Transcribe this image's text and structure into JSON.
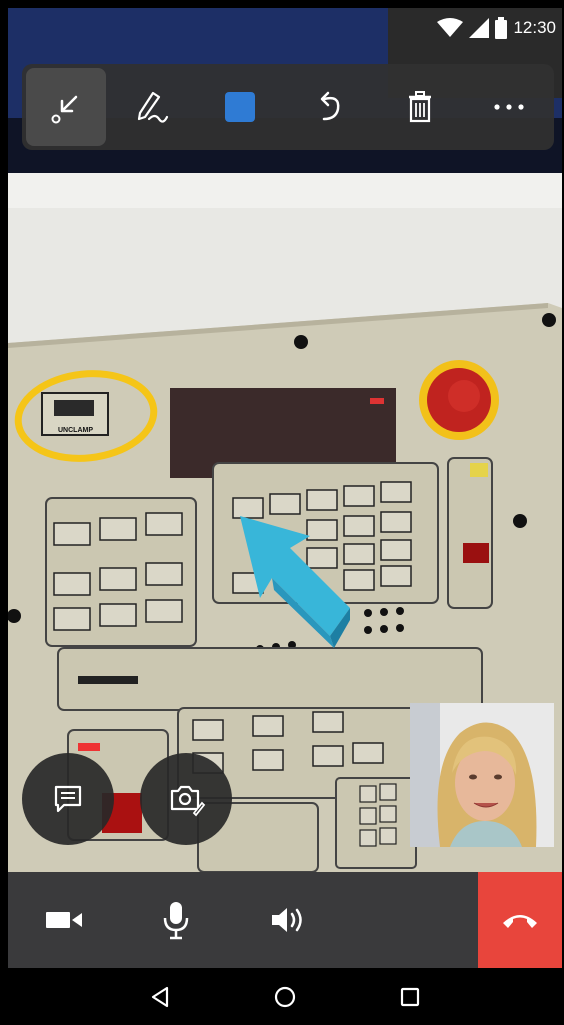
{
  "status_bar": {
    "time": "12:30",
    "icons": [
      "wifi-icon",
      "signal-icon",
      "battery-icon"
    ]
  },
  "toolbar": {
    "tools": [
      {
        "name": "pointer-arrow-tool",
        "icon": "arrow-down-left-icon",
        "active": true
      },
      {
        "name": "pen-tool",
        "icon": "pen-icon"
      },
      {
        "name": "color-tool",
        "icon": "color-swatch",
        "color": "#2f7bd4"
      },
      {
        "name": "undo-tool",
        "icon": "undo-icon"
      },
      {
        "name": "delete-tool",
        "icon": "trash-icon"
      },
      {
        "name": "more-tool",
        "icon": "more-horizontal-icon"
      }
    ]
  },
  "annotations": {
    "circle_color": "#f5c518",
    "arrow_color": "#38b6d9"
  },
  "panel_labels": {
    "unclamp": "UNCLAMP"
  },
  "floating_buttons": [
    {
      "name": "chat-button",
      "icon": "chat-icon"
    },
    {
      "name": "snapshot-button",
      "icon": "camera-annotate-icon"
    }
  ],
  "call_bar": {
    "buttons": [
      {
        "name": "video-toggle-button",
        "icon": "video-camera-icon"
      },
      {
        "name": "mic-toggle-button",
        "icon": "microphone-icon"
      },
      {
        "name": "speaker-toggle-button",
        "icon": "speaker-icon"
      },
      {
        "name": "end-call-button",
        "icon": "phone-hangup-icon",
        "color": "#e8453c"
      }
    ]
  },
  "nav_bar": {
    "buttons": [
      {
        "name": "nav-back-button",
        "icon": "back-triangle-icon"
      },
      {
        "name": "nav-home-button",
        "icon": "home-circle-icon"
      },
      {
        "name": "nav-recents-button",
        "icon": "recents-square-icon"
      }
    ]
  }
}
